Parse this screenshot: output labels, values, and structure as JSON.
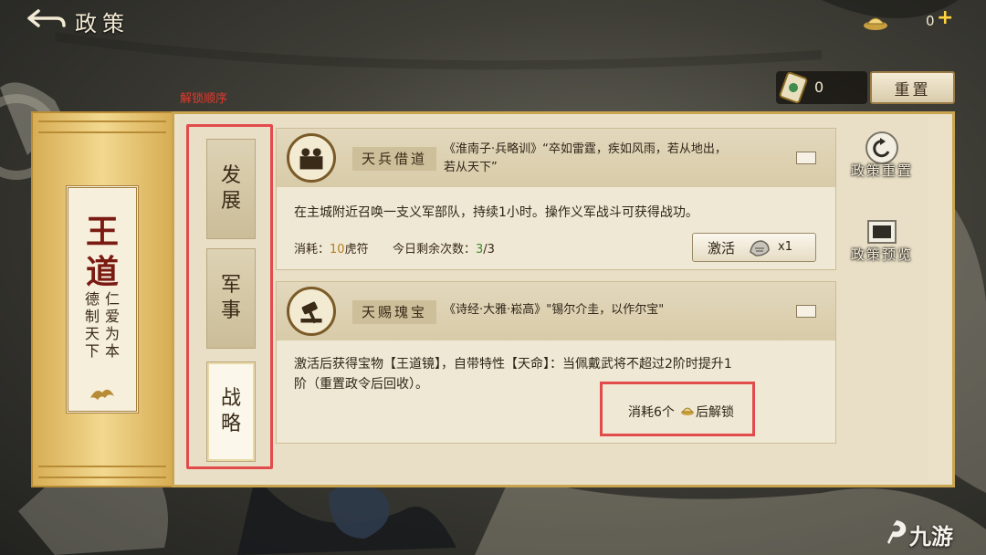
{
  "header": {
    "title": "政策",
    "coins": "0",
    "plus": "+"
  },
  "resource": {
    "token_count": "0",
    "reset_label": "重置"
  },
  "note": {
    "unlock_order": "解锁顺序"
  },
  "path": {
    "name": "王道",
    "motto_right": "仁爱为本",
    "motto_left": "德制天下"
  },
  "tabs": [
    {
      "label_top": "发",
      "label_bottom": "展"
    },
    {
      "label_top": "军",
      "label_bottom": "事"
    },
    {
      "label_top": "战",
      "label_bottom": "略"
    }
  ],
  "cards": [
    {
      "name": "天兵借道",
      "quote_line1": "《淮南子·兵略训》“卒如雷霆，疾如风雨，若从地出，",
      "quote_line2": "若从天下”",
      "description": "在主城附近召唤一支义军部队，持续1小时。操作义军战斗可获得战功。",
      "cost_prefix": "消耗：",
      "cost_amount": "10",
      "cost_item": "虎符",
      "remaining_label": "今日剩余次数：",
      "remaining_used": "3",
      "remaining_total": "/3",
      "activate_label": "激活",
      "activate_qty": "x1"
    },
    {
      "name": "天赐瑰宝",
      "quote_line1": "《诗经·大雅·崧高》\"锡尔介圭，以作尔宝\"",
      "description_line1": "激活后获得宝物【王道镜】，自带特性【天命】：当佩戴武将不超过2阶时提升1",
      "description_line2": "阶（重置政令后回收）。",
      "unlock_prefix": "消耗6个",
      "unlock_suffix": "后解锁"
    }
  ],
  "side": {
    "reset_label": "政策重置",
    "preview_label": "政策预览"
  },
  "watermark": {
    "text": "九游"
  },
  "colors": {
    "highlight_red": "#e24b4b",
    "gold": "#d7ad54",
    "accent_yellow": "#ffd23f",
    "count_green": "#3d8a2c",
    "count_orange": "#b67e1a"
  }
}
